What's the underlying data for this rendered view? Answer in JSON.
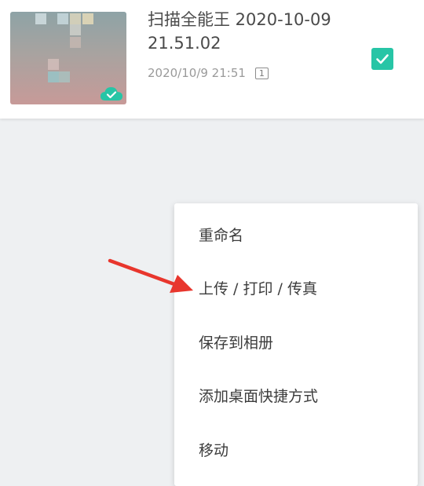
{
  "document": {
    "title": "扫描全能王 2020-10-09 21.51.02",
    "date": "2020/10/9 21:51",
    "page_count": "1",
    "selected": true,
    "synced_icon": "cloud-check-icon"
  },
  "menu": {
    "items": [
      {
        "label": "重命名"
      },
      {
        "label": "上传 / 打印 / 传真"
      },
      {
        "label": "保存到相册"
      },
      {
        "label": "添加桌面快捷方式"
      },
      {
        "label": "移动"
      }
    ]
  },
  "colors": {
    "accent": "#27c5a6",
    "arrow": "#e8362d",
    "background": "#eef0f2"
  },
  "annotation": {
    "icon": "red-arrow-icon",
    "points_to": "上传 / 打印 / 传真"
  }
}
